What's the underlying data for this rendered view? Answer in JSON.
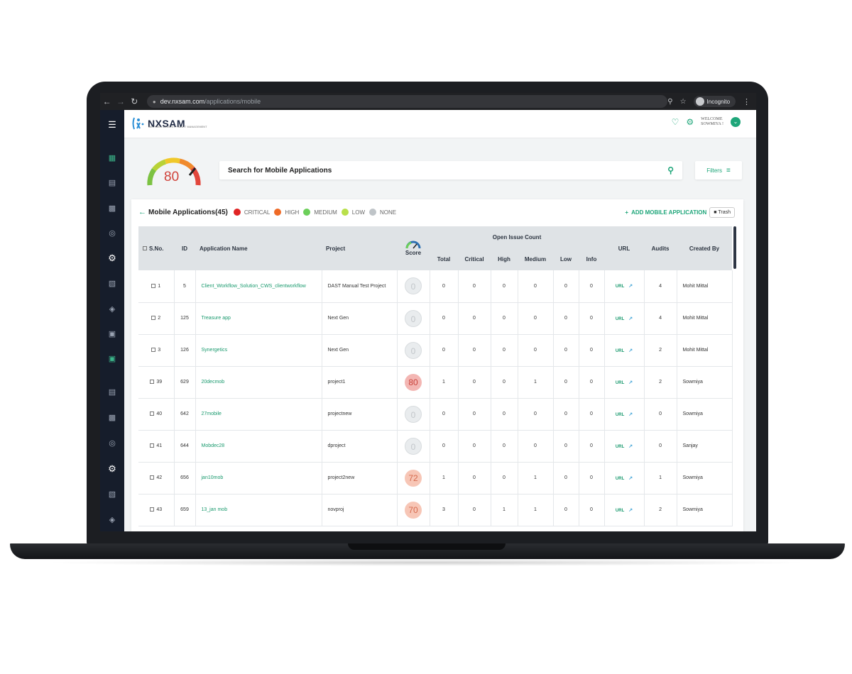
{
  "browser": {
    "url_host": "dev.nxsam.com",
    "url_path": "/applications/mobile",
    "incognito_label": "Incognito"
  },
  "header": {
    "logo_text": "NXSAM",
    "logo_subtitle": "NEXTGEN SECURITY AUDIT MANAGEMENT",
    "welcome_line1": "WELCOME",
    "welcome_line2": "SOWMIYA !"
  },
  "overall_score": "80",
  "search": {
    "placeholder": "Search for Mobile Applications"
  },
  "filters_label": "Filters",
  "card": {
    "title": "Mobile Applications(45)",
    "add_label": "ADD MOBILE APPLICATION",
    "trash_label": "Trash"
  },
  "legend": [
    {
      "label": "CRITICAL",
      "color": "#e02424"
    },
    {
      "label": "HIGH",
      "color": "#ef6a26"
    },
    {
      "label": "MEDIUM",
      "color": "#6ccf5a"
    },
    {
      "label": "LOW",
      "color": "#b9e04a"
    },
    {
      "label": "NONE",
      "color": "#bfc4c8"
    }
  ],
  "table": {
    "headers": {
      "sno": "S.No.",
      "id": "ID",
      "app_name": "Application Name",
      "project": "Project",
      "score": "Score",
      "open_issue": "Open Issue Count",
      "total": "Total",
      "critical": "Critical",
      "high": "High",
      "medium": "Medium",
      "low": "Low",
      "info": "Info",
      "url": "URL",
      "audits": "Audits",
      "created_by": "Created By"
    },
    "rows": [
      {
        "sno": "1",
        "id": "5",
        "name": "Client_Workflow_Solution_CWS_clientworkflow",
        "project": "DAST Manual Test Project",
        "score": "0",
        "total": "0",
        "critical": "0",
        "high": "0",
        "medium": "0",
        "low": "0",
        "info": "0",
        "url": "URL",
        "audits": "4",
        "created_by": "Mohit Mittal"
      },
      {
        "sno": "2",
        "id": "125",
        "name": "Treasure app",
        "project": "Next Gen",
        "score": "0",
        "total": "0",
        "critical": "0",
        "high": "0",
        "medium": "0",
        "low": "0",
        "info": "0",
        "url": "URL",
        "audits": "4",
        "created_by": "Mohit Mittal"
      },
      {
        "sno": "3",
        "id": "126",
        "name": "Synergetics",
        "project": "Next Gen",
        "score": "0",
        "total": "0",
        "critical": "0",
        "high": "0",
        "medium": "0",
        "low": "0",
        "info": "0",
        "url": "URL",
        "audits": "2",
        "created_by": "Mohit Mittal"
      },
      {
        "sno": "39",
        "id": "629",
        "name": "20decmob",
        "project": "project1",
        "score": "80",
        "total": "1",
        "critical": "0",
        "high": "0",
        "medium": "1",
        "low": "0",
        "info": "0",
        "url": "URL",
        "audits": "2",
        "created_by": "Sowmiya"
      },
      {
        "sno": "40",
        "id": "642",
        "name": "27mobile",
        "project": "projectnew",
        "score": "0",
        "total": "0",
        "critical": "0",
        "high": "0",
        "medium": "0",
        "low": "0",
        "info": "0",
        "url": "URL",
        "audits": "0",
        "created_by": "Sowmiya"
      },
      {
        "sno": "41",
        "id": "644",
        "name": "Mobdec28",
        "project": "dproject",
        "score": "0",
        "total": "0",
        "critical": "0",
        "high": "0",
        "medium": "0",
        "low": "0",
        "info": "0",
        "url": "URL",
        "audits": "0",
        "created_by": "Sanjay"
      },
      {
        "sno": "42",
        "id": "656",
        "name": "jan10mob",
        "project": "project2new",
        "score": "72",
        "total": "1",
        "critical": "0",
        "high": "0",
        "medium": "1",
        "low": "0",
        "info": "0",
        "url": "URL",
        "audits": "1",
        "created_by": "Sowmiya"
      },
      {
        "sno": "43",
        "id": "659",
        "name": "13_jan mob",
        "project": "novproj",
        "score": "70",
        "total": "3",
        "critical": "0",
        "high": "1",
        "medium": "1",
        "low": "0",
        "info": "0",
        "url": "URL",
        "audits": "2",
        "created_by": "Sowmiya"
      }
    ]
  },
  "colors": {
    "accent": "#1fa67a",
    "sidebar_bg": "#161d2b"
  }
}
